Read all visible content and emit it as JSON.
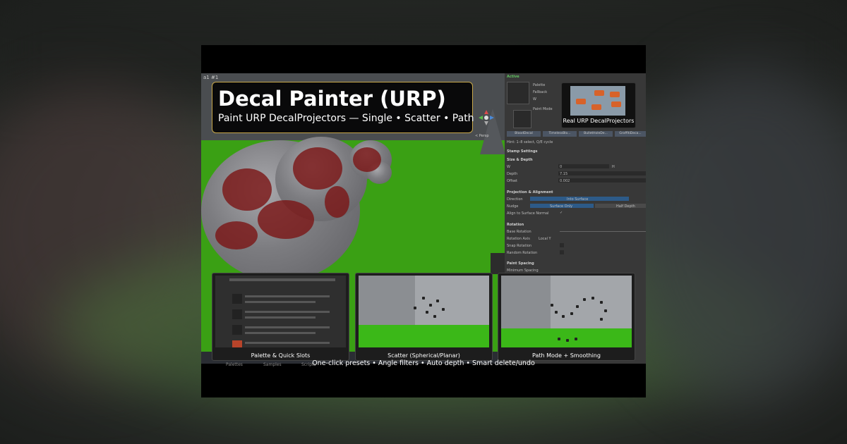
{
  "title_card": {
    "title": "Decal Painter (URP)",
    "subtitle": "Paint URP DecalProjectors — Single • Scatter • Path"
  },
  "urp_preview": {
    "label": "Real URP DecalProjectors"
  },
  "scene": {
    "top_label": "a1 #1",
    "gizmo_label": "< Persp"
  },
  "inspector": {
    "header": "Active",
    "fields": [
      "Palette",
      "Fallback",
      "W"
    ],
    "paint_mode": "Paint Mode",
    "slots": [
      "BloodDecal",
      "TimelessBlo...",
      "BulletHoleDe...",
      "GraffitiDeca..."
    ],
    "hint": "Hint: 1–8 select, Q/E cycle",
    "stamp_settings": "Stamp Settings",
    "size_depth": "Size & Depth",
    "size_w": "W",
    "size_w_value": "0",
    "size_h": "H",
    "depth_label": "Depth",
    "depth_value": "7.15",
    "offset_label": "Offset",
    "offset_value": "0.002",
    "projection_header": "Projection & Alignment",
    "direction_label": "Direction",
    "direction_value": "Into Surface",
    "nudge_label": "Nudge",
    "nudge_a": "Surface Only",
    "nudge_b": "Half Depth",
    "align_label": "Align to Surface Normal",
    "rotation_header": "Rotation",
    "base_rotation": "Base Rotation",
    "rotation_axis": "Rotation Axis",
    "rotation_axis_value": "Local Y",
    "snap_rotation": "Snap Rotation",
    "random_rotation": "Random Rotation",
    "paint_spacing": "Paint Spacing",
    "minimum_spacing": "Minimum Spacing"
  },
  "thumbnails": [
    {
      "label": "Palette & Quick Slots"
    },
    {
      "label": "Scatter (Spherical/Planar)"
    },
    {
      "label": "Path Mode + Smoothing"
    }
  ],
  "footer": {
    "text": "One-click presets • Angle filters • Auto depth • Smart delete/undo",
    "tabs": [
      "Palettes",
      "Samples",
      "Scripts"
    ]
  },
  "colors": {
    "accent_border": "#c8a84a",
    "ground": "#3aa014",
    "decal_red": "#7a1414"
  }
}
